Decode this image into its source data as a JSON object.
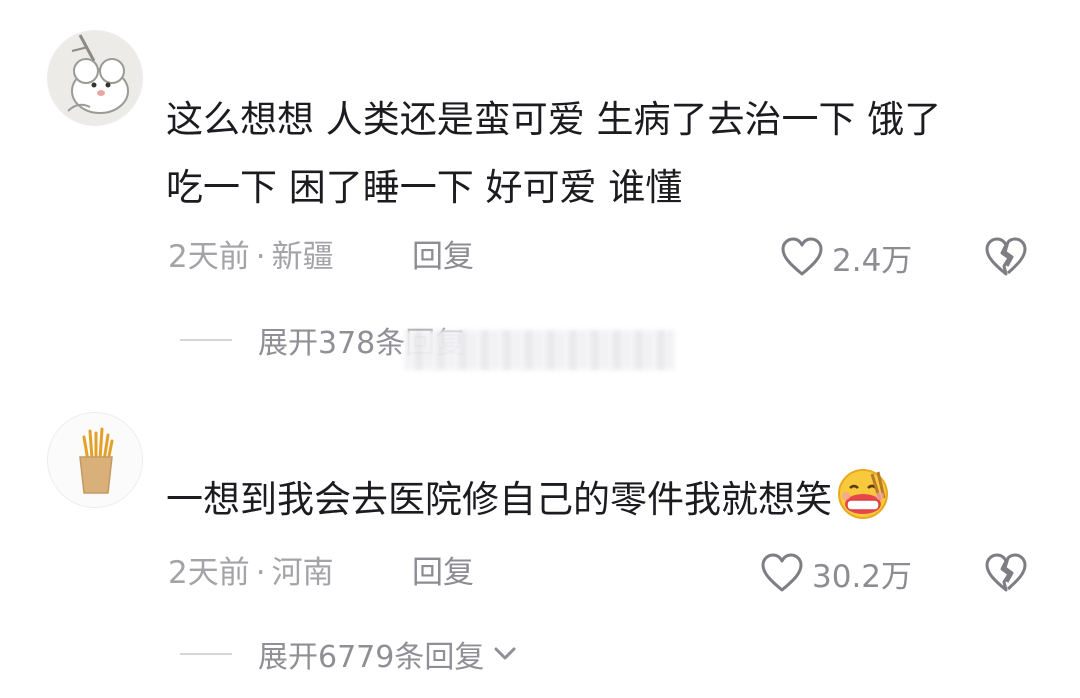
{
  "comments": [
    {
      "text_line1": "这么想想 人类还是蛮可爱 生病了去治一下 饿了",
      "text_line2": "吃一下 困了睡一下 好可爱 谁懂",
      "time": "2天前",
      "separator": "·",
      "location": "新疆",
      "reply_label": "回复",
      "likes": "2.4万",
      "expand_label": "展开378条回复",
      "avatar_icon": "cartoon-bear-swing-icon"
    },
    {
      "text_line1": "一想到我会去医院修自己的零件我就想笑",
      "emoji_icon": "laughing-eating-emoji-icon",
      "time": "2天前",
      "separator": "·",
      "location": "河南",
      "reply_label": "回复",
      "likes": "30.2万",
      "expand_label": "展开6779条回复",
      "avatar_icon": "french-fries-icon"
    }
  ],
  "icons": {
    "like": "heart-outline-icon",
    "dislike": "broken-heart-icon",
    "expand": "chevron-down-icon"
  },
  "colors": {
    "text": "#1b1b20",
    "meta": "#a3a3a8",
    "action": "#8c8c92",
    "accent_emoji": "#f5b82e"
  }
}
